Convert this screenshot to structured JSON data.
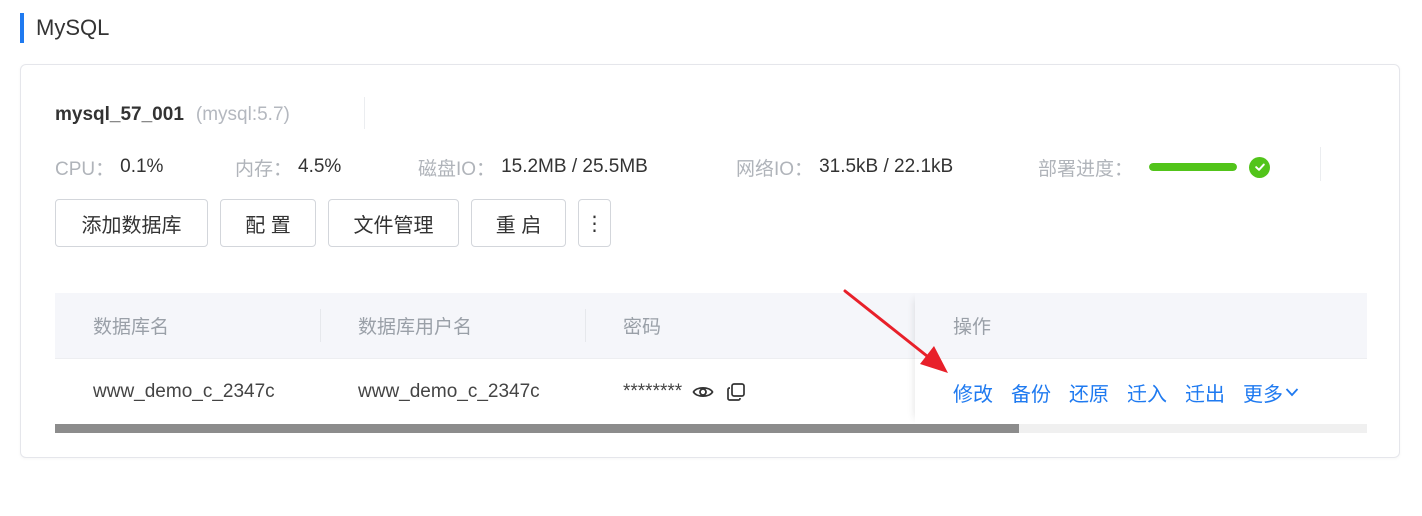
{
  "section": {
    "title": "MySQL"
  },
  "instance": {
    "name": "mysql_57_001",
    "version": "(mysql:5.7)"
  },
  "stats": {
    "cpu_label": "CPU：",
    "cpu_value": "0.1%",
    "mem_label": "内存：",
    "mem_value": "4.5%",
    "disk_label": "磁盘IO：",
    "disk_value": "15.2MB / 25.5MB",
    "net_label": "网络IO：",
    "net_value": "31.5kB / 22.1kB",
    "deploy_label": "部署进度：",
    "deploy_progress": 1.0
  },
  "buttons": {
    "add_db": "添加数据库",
    "config": "配 置",
    "file_mgmt": "文件管理",
    "restart": "重 启",
    "more": "⋮"
  },
  "table": {
    "columns": [
      "数据库名",
      "数据库用户名",
      "密码",
      "操作"
    ],
    "rows": [
      {
        "db_name": "www_demo_c_2347c",
        "db_user": "www_demo_c_2347c",
        "password": "********"
      }
    ],
    "actions": [
      "修改",
      "备份",
      "还原",
      "迁入",
      "迁出",
      "更多"
    ],
    "scroll_fraction": 0.735
  },
  "colors": {
    "accent": "#1f7af0",
    "success": "#52c41a",
    "annotation_arrow": "#e8202a"
  },
  "icons": [
    "eye-icon",
    "copy-icon",
    "check-circle-icon",
    "chevron-down-icon",
    "kebab-menu-icon"
  ]
}
